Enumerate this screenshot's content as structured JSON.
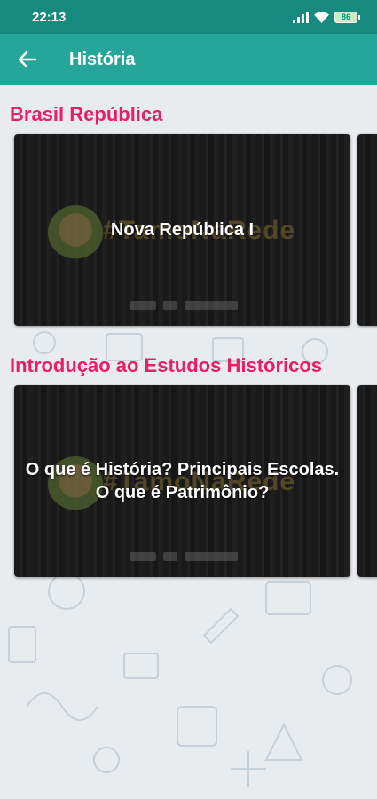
{
  "status_bar": {
    "time": "22:13",
    "battery": "86",
    "icons": [
      "signal-icon",
      "wifi-icon",
      "battery-icon"
    ]
  },
  "app_bar": {
    "back_icon": "arrow-left-icon",
    "title": "História"
  },
  "sections": [
    {
      "title": "Brasil República",
      "cards": [
        {
          "title": "Nova República I",
          "brand": "#TamoNaRede"
        }
      ]
    },
    {
      "title": "Introdução ao Estudos Históricos",
      "cards": [
        {
          "title": "O que é História? Principais Escolas. O que é Patrimônio?",
          "brand": "#TamoNaRede"
        }
      ]
    }
  ],
  "colors": {
    "status_bar": "#178a80",
    "app_bar": "#26a69a",
    "section_title": "#e91e63",
    "background": "#e9ecef"
  }
}
